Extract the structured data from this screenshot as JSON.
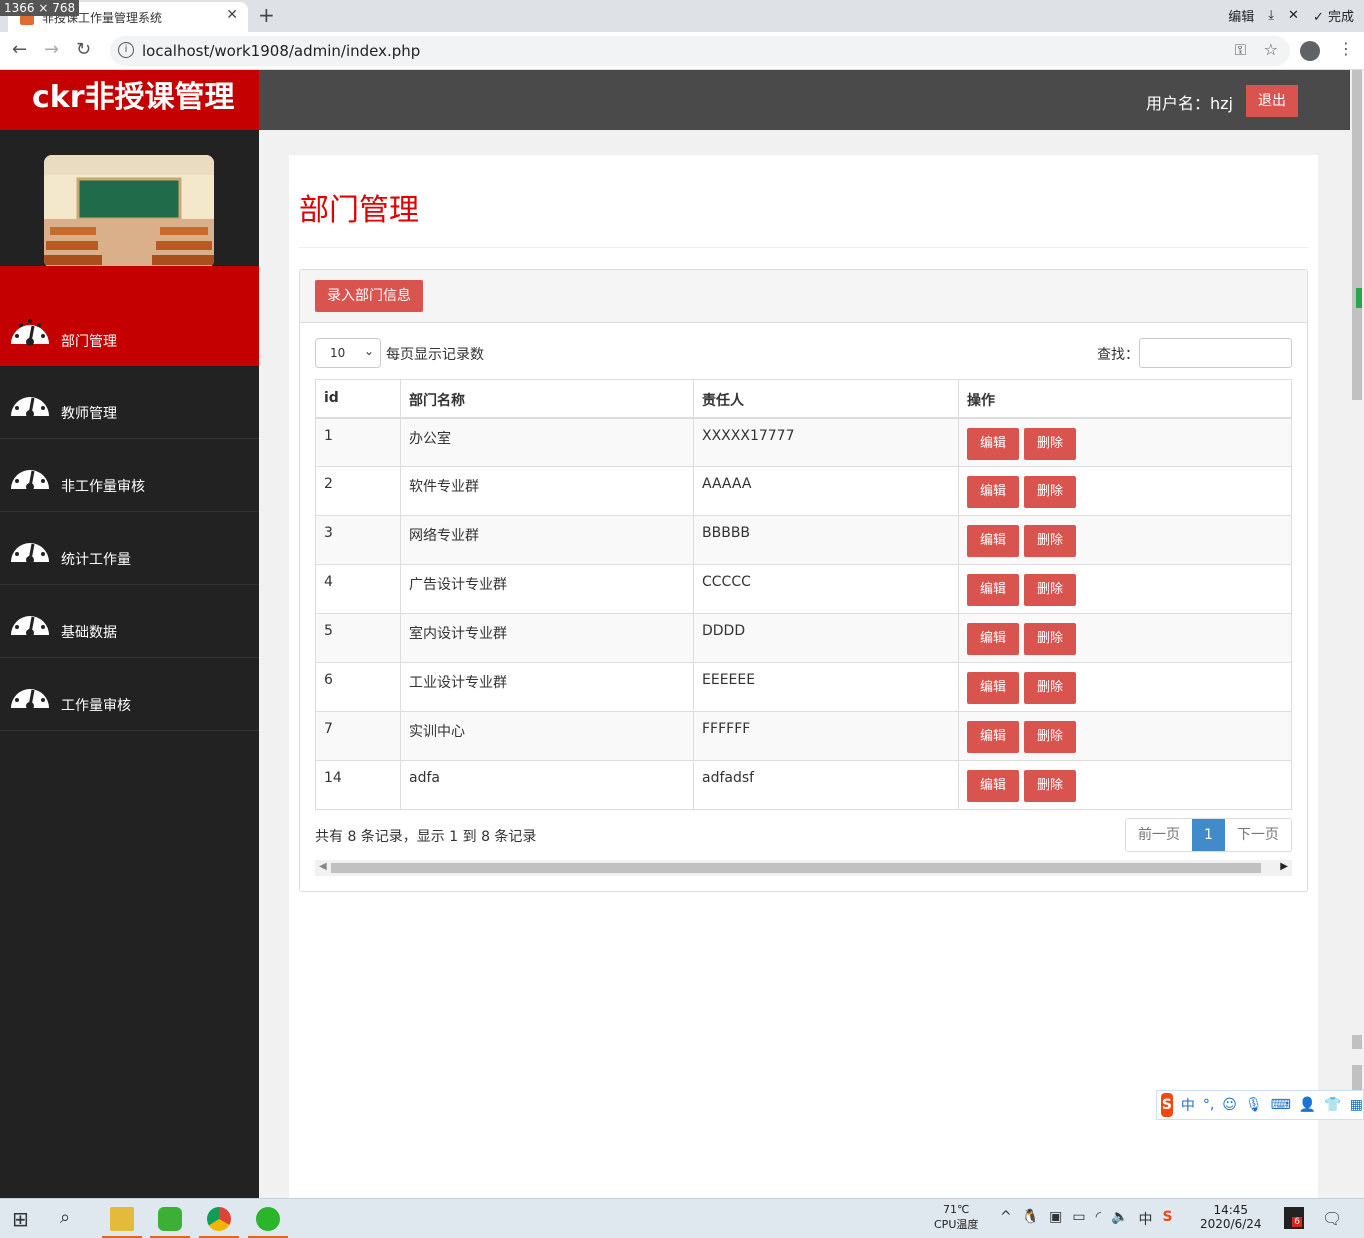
{
  "browser": {
    "size_tag": "1366 × 768",
    "tab_title": "非授课工作量管理系统",
    "tab_close": "✕",
    "new_tab": "+",
    "top_actions": [
      "编辑",
      "完成"
    ],
    "url": "localhost/work1908/admin/index.php"
  },
  "header": {
    "logo": "ckr非授课管理",
    "user_label": "用户名：hzj",
    "logout": "退出"
  },
  "sidebar": {
    "items": [
      {
        "label": "部门管理",
        "active": true
      },
      {
        "label": "教师管理",
        "active": false
      },
      {
        "label": "非工作量审核",
        "active": false
      },
      {
        "label": "统计工作量",
        "active": false
      },
      {
        "label": "基础数据",
        "active": false
      },
      {
        "label": "工作量审核",
        "active": false
      }
    ]
  },
  "main": {
    "title": "部门管理",
    "add_button": "录入部门信息",
    "page_length": "10",
    "page_length_label": "每页显示记录数",
    "search_label": "查找：",
    "columns": [
      "id",
      "部门名称",
      "责任人",
      "操作"
    ],
    "rows": [
      {
        "id": "1",
        "name": "办公室",
        "owner": "XXXXX17777"
      },
      {
        "id": "2",
        "name": "软件专业群",
        "owner": "AAAAA"
      },
      {
        "id": "3",
        "name": "网络专业群",
        "owner": "BBBBB"
      },
      {
        "id": "4",
        "name": "广告设计专业群",
        "owner": "CCCCC"
      },
      {
        "id": "5",
        "name": "室内设计专业群",
        "owner": "DDDD"
      },
      {
        "id": "6",
        "name": "工业设计专业群",
        "owner": "EEEEEE"
      },
      {
        "id": "7",
        "name": "实训中心",
        "owner": "FFFFFF"
      },
      {
        "id": "14",
        "name": "adfa",
        "owner": "adfadsf"
      }
    ],
    "edit_label": "编辑",
    "delete_label": "删除",
    "info": "共有 8 条记录，显示 1 到 8 条记录",
    "pager": {
      "prev": "前一页",
      "current": "1",
      "next": "下一页"
    }
  },
  "ime": {
    "logo": "S",
    "mode": "中",
    "punct": "°,"
  },
  "taskbar": {
    "cpu_temp": "71℃",
    "cpu_label": "CPU温度",
    "time": "14:45",
    "date": "2020/6/24",
    "badge": "6"
  },
  "colors": {
    "brand_red": "#c40000",
    "button_red": "#d9534f",
    "header_gray": "#4a4a4a",
    "sidebar_dark": "#222222",
    "pager_blue": "#428bca"
  }
}
